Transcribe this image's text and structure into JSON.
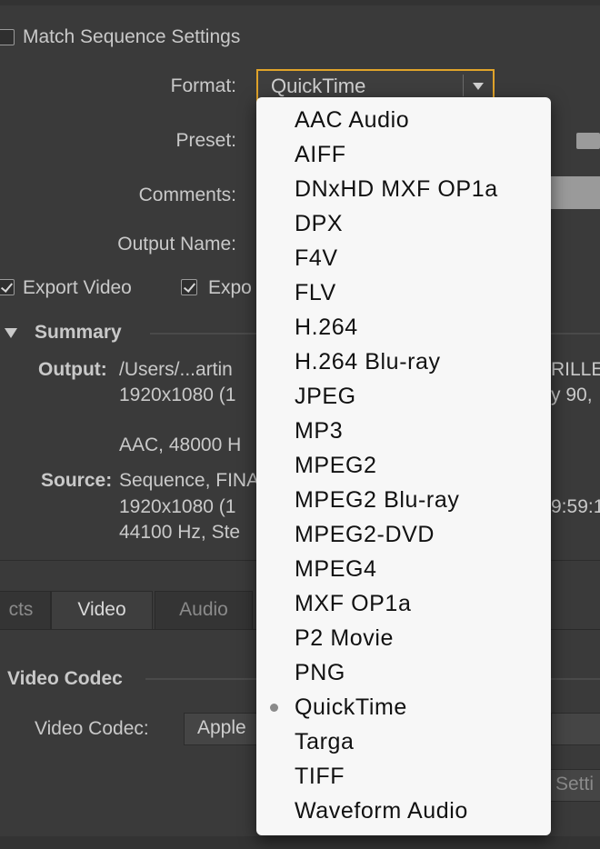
{
  "match_sequence": {
    "label": "Match Sequence Settings",
    "checked": false
  },
  "format": {
    "label": "Format:",
    "value": "QuickTime"
  },
  "preset": {
    "label": "Preset:"
  },
  "comments": {
    "label": "Comments:"
  },
  "output_name": {
    "label": "Output Name:"
  },
  "export_video": {
    "label": "Export Video",
    "checked": true
  },
  "export_audio": {
    "label": "Expo",
    "checked": true
  },
  "summary": {
    "title": "Summary",
    "output_label": "Output:",
    "output_lines": [
      "/Users/...artin",
      "1920x1080 (1",
      "AAC, 48000 H"
    ],
    "source_label": "Source:",
    "source_lines": [
      "Sequence, FINA",
      "1920x1080 (1",
      "44100 Hz, Ste"
    ],
    "right_fragments": {
      "line1": "RILLEX",
      "line2": "y 90,",
      "src2": "9:59:1"
    }
  },
  "tabs": [
    {
      "label": "cts",
      "active": false
    },
    {
      "label": "Video",
      "active": true
    },
    {
      "label": "Audio",
      "active": false
    }
  ],
  "video_codec": {
    "section_title": "Video Codec",
    "label": "Video Codec:",
    "value": "Apple",
    "settings_button": "Setti"
  },
  "format_menu": {
    "items": [
      "AAC Audio",
      "AIFF",
      "DNxHD MXF OP1a",
      "DPX",
      "F4V",
      "FLV",
      "H.264",
      "H.264 Blu-ray",
      "JPEG",
      "MP3",
      "MPEG2",
      "MPEG2 Blu-ray",
      "MPEG2-DVD",
      "MPEG4",
      "MXF OP1a",
      "P2 Movie",
      "PNG",
      "QuickTime",
      "Targa",
      "TIFF",
      "Waveform Audio"
    ],
    "selected": "QuickTime"
  },
  "colors": {
    "panel_bg": "#3a3a3a",
    "focus_ring": "#e0a32a",
    "menu_bg": "#f7f7f7",
    "menu_text": "#111111"
  }
}
